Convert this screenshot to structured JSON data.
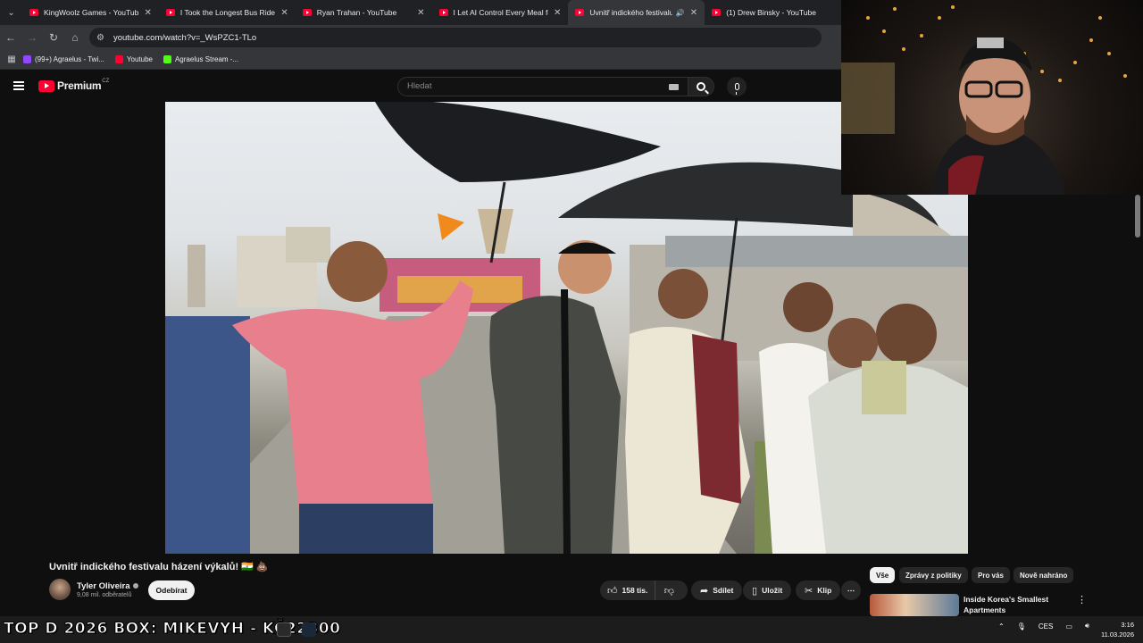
{
  "browser": {
    "tabs": [
      {
        "title": "KingWoolz Games - YouTube",
        "active": false
      },
      {
        "title": "I Took the Longest Bus Ride in",
        "active": false
      },
      {
        "title": "Ryan Trahan - YouTube",
        "active": false
      },
      {
        "title": "I Let AI Control Every Meal for",
        "active": false
      },
      {
        "title": "Uvnitř indického festivalu h",
        "active": true
      },
      {
        "title": "(1) Drew Binsky - YouTube",
        "active": false
      }
    ],
    "url": "youtube.com/watch?v=_WsPZC1-TLo",
    "bookmarks": [
      {
        "label": "(99+) Agraelus - Twi...",
        "color": "#9146ff"
      },
      {
        "label": "Youtube",
        "color": "#ff0033"
      },
      {
        "label": "Agraelus Stream -...",
        "color": "#53fc18"
      }
    ]
  },
  "youtube": {
    "logo_text": "Premium",
    "region": "CZ",
    "search_placeholder": "Hledat"
  },
  "video": {
    "title": "Uvnitř indického festivalu házení výkalů! 🇮🇳 💩",
    "channel": "Tyler Oliveira",
    "subscribers": "9,08 mil. odběratelů",
    "subscribe_label": "Odebírat",
    "likes": "158 tis.",
    "share_label": "Sdílet",
    "save_label": "Uložit",
    "clip_label": "Klip"
  },
  "sidebar": {
    "chips": [
      "Vše",
      "Zprávy z politiky",
      "Pro vás",
      "Nově nahráno"
    ],
    "recommendation_title": "Inside Korea's Smallest Apartments"
  },
  "taskbar": {
    "ticker": "TOP D 2026 BOX: MIKEVYH - KČ22300",
    "language": "CES",
    "time": "3:16",
    "date": "11.03.2026"
  },
  "colors": {
    "yt_red": "#ff0033",
    "background": "#0f0f0f",
    "chip_bg": "#272727"
  }
}
